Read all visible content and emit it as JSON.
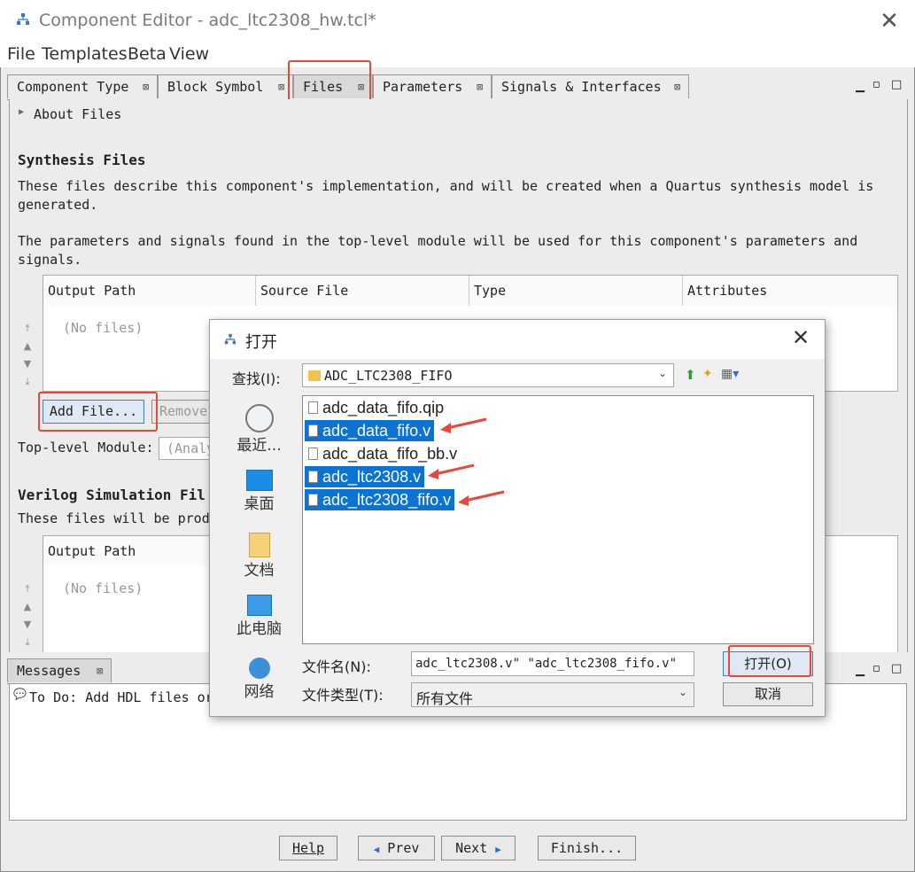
{
  "window": {
    "title": "Component Editor - adc_ltc2308_hw.tcl*"
  },
  "menu": [
    "File",
    "Templates",
    "Beta",
    "View"
  ],
  "tabs": [
    {
      "label": "Component Type",
      "close": "⊠"
    },
    {
      "label": "Block Symbol",
      "close": "⊠"
    },
    {
      "label": "Files",
      "close": "⊠"
    },
    {
      "label": "Parameters",
      "close": "⊠"
    },
    {
      "label": "Signals & Interfaces",
      "close": "⊠"
    }
  ],
  "files_page": {
    "about": "About Files",
    "synth_heading": "Synthesis Files",
    "synth_desc1_l1": "These files describe this component's implementation, and will be created when a Quartus synthesis model is",
    "synth_desc1_l2": "generated.",
    "synth_desc2_l1": "The parameters and signals found in the top-level module will be used for this component's parameters and",
    "synth_desc2_l2": "signals.",
    "table_headers": [
      "Output Path",
      "Source File",
      "Type",
      "Attributes"
    ],
    "no_files": "(No files)",
    "add_file": "Add File...",
    "remove": "Remove",
    "top_level_label": "Top-level Module:",
    "top_level_value": "(Analy",
    "verilog_heading": "Verilog Simulation Fil",
    "verilog_desc": "These files will be prod",
    "sim_header": "Output Path",
    "sim_no_files": "(No files)"
  },
  "messages": {
    "tab": "Messages",
    "tab_close": "⊠",
    "line": "To Do: Add HDL files or"
  },
  "nav": {
    "help": "Help",
    "prev": "Prev",
    "next": "Next",
    "finish": "Finish..."
  },
  "dialog": {
    "title": "打开",
    "lookin_label": "查找(I):",
    "lookin_value": "ADC_LTC2308_FIFO",
    "places": [
      "最近...",
      "桌面",
      "文档",
      "此电脑",
      "网络"
    ],
    "files": [
      {
        "name": "adc_data_fifo.qip",
        "selected": false
      },
      {
        "name": "adc_data_fifo.v",
        "selected": true
      },
      {
        "name": "adc_data_fifo_bb.v",
        "selected": false
      },
      {
        "name": "adc_ltc2308.v",
        "selected": true
      },
      {
        "name": "adc_ltc2308_fifo.v",
        "selected": true
      }
    ],
    "filename_label": "文件名(N):",
    "filename_value": "adc_ltc2308.v\" \"adc_ltc2308_fifo.v\"",
    "filetype_label": "文件类型(T):",
    "filetype_value": "所有文件",
    "open_btn": "打开(O)",
    "cancel_btn": "取消"
  },
  "colors": {
    "selection": "#0b73d4",
    "annotation": "#e8473c"
  }
}
